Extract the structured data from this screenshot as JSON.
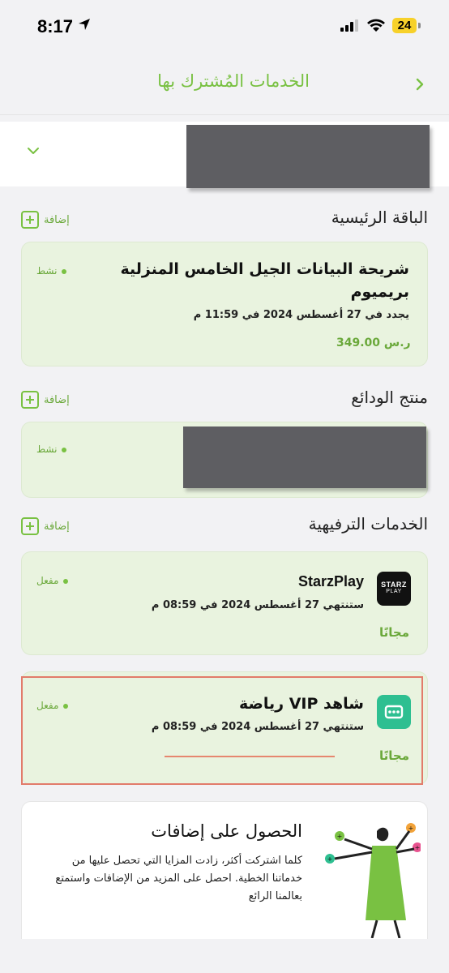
{
  "status_bar": {
    "time": "8:17",
    "battery": "24"
  },
  "header": {
    "title": "الخدمات المُشترك بها"
  },
  "sections": {
    "main_plan": {
      "title": "الباقة الرئيسية",
      "add_label": "إضافة",
      "card": {
        "name_line1": "شريحة البيانات الجيل الخامس المنزلية",
        "name_line2": "بريميوم",
        "status": "نشط",
        "renewal": "يجدد في 27 أغسطس 2024 في 11:59 م",
        "price": "349.00 ر.س"
      }
    },
    "deposits": {
      "title": "منتج الودائع",
      "add_label": "إضافة",
      "card": {
        "status": "نشط"
      }
    },
    "entertainment": {
      "title": "الخدمات الترفيهية",
      "add_label": "إضافة",
      "cards": [
        {
          "name": "StarzPlay",
          "logo_text": "STARZ",
          "logo_sub": "PLAY",
          "status": "مفعل",
          "expiry": "ستنتهي 27 أغسطس 2024 في 08:59 م",
          "price": "مجانًا"
        },
        {
          "name": "شاهد VIP رياضة",
          "status": "مفعل",
          "expiry": "ستنتهي 27 أغسطس 2024 في 08:59 م",
          "price": "مجانًا"
        }
      ]
    }
  },
  "promo": {
    "title": "الحصول على إضافات",
    "body": "كلما اشتركت أكثر، زادت المزايا التي تحصل عليها من خدماتنا الخطية. احصل على المزيد من الإضافات واستمتع بعالمنا الرائع"
  },
  "colors": {
    "accent": "#79c142",
    "card_bg": "#e9f3df",
    "shahid": "#2ebf91"
  }
}
